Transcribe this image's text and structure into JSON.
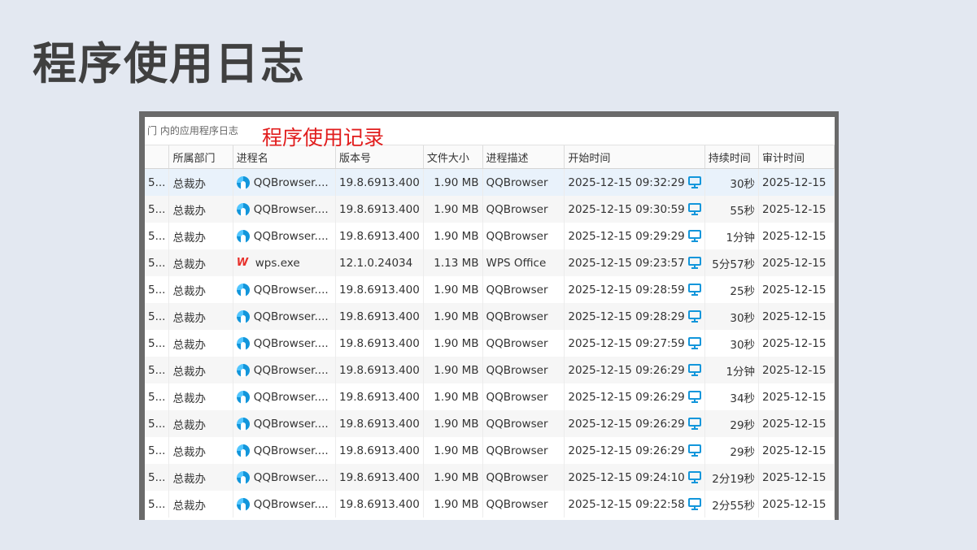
{
  "page": {
    "title": "程序使用日志"
  },
  "panel": {
    "breadcrumb": "门 内的应用程序日志",
    "annotation": "程序使用记录"
  },
  "columns": [
    "",
    "所属部门",
    "进程名",
    "版本号",
    "文件大小",
    "进程描述",
    "开始时间",
    "持续时间",
    "审计时间"
  ],
  "rows": [
    {
      "first": "5...",
      "dept": "总裁办",
      "icon": "qqbrowser-icon",
      "proc": "QQBrowser....",
      "ver": "19.8.6913.400",
      "size": "1.90 MB",
      "desc": "QQBrowser",
      "start": "2025-12-15 09:32:29",
      "dur": "30秒",
      "audit": "2025-12-15"
    },
    {
      "first": "5...",
      "dept": "总裁办",
      "icon": "qqbrowser-icon",
      "proc": "QQBrowser....",
      "ver": "19.8.6913.400",
      "size": "1.90 MB",
      "desc": "QQBrowser",
      "start": "2025-12-15 09:30:59",
      "dur": "55秒",
      "audit": "2025-12-15"
    },
    {
      "first": "5...",
      "dept": "总裁办",
      "icon": "qqbrowser-icon",
      "proc": "QQBrowser....",
      "ver": "19.8.6913.400",
      "size": "1.90 MB",
      "desc": "QQBrowser",
      "start": "2025-12-15 09:29:29",
      "dur": "1分钟",
      "audit": "2025-12-15"
    },
    {
      "first": "5...",
      "dept": "总裁办",
      "icon": "wps-icon",
      "proc": "wps.exe",
      "ver": "12.1.0.24034",
      "size": "1.13 MB",
      "desc": "WPS Office",
      "start": "2025-12-15 09:23:57",
      "dur": "5分57秒",
      "audit": "2025-12-15"
    },
    {
      "first": "5...",
      "dept": "总裁办",
      "icon": "qqbrowser-icon",
      "proc": "QQBrowser....",
      "ver": "19.8.6913.400",
      "size": "1.90 MB",
      "desc": "QQBrowser",
      "start": "2025-12-15 09:28:59",
      "dur": "25秒",
      "audit": "2025-12-15"
    },
    {
      "first": "5...",
      "dept": "总裁办",
      "icon": "qqbrowser-icon",
      "proc": "QQBrowser....",
      "ver": "19.8.6913.400",
      "size": "1.90 MB",
      "desc": "QQBrowser",
      "start": "2025-12-15 09:28:29",
      "dur": "30秒",
      "audit": "2025-12-15"
    },
    {
      "first": "5...",
      "dept": "总裁办",
      "icon": "qqbrowser-icon",
      "proc": "QQBrowser....",
      "ver": "19.8.6913.400",
      "size": "1.90 MB",
      "desc": "QQBrowser",
      "start": "2025-12-15 09:27:59",
      "dur": "30秒",
      "audit": "2025-12-15"
    },
    {
      "first": "5...",
      "dept": "总裁办",
      "icon": "qqbrowser-icon",
      "proc": "QQBrowser....",
      "ver": "19.8.6913.400",
      "size": "1.90 MB",
      "desc": "QQBrowser",
      "start": "2025-12-15 09:26:29",
      "dur": "1分钟",
      "audit": "2025-12-15"
    },
    {
      "first": "5...",
      "dept": "总裁办",
      "icon": "qqbrowser-icon",
      "proc": "QQBrowser....",
      "ver": "19.8.6913.400",
      "size": "1.90 MB",
      "desc": "QQBrowser",
      "start": "2025-12-15 09:26:29",
      "dur": "34秒",
      "audit": "2025-12-15"
    },
    {
      "first": "5...",
      "dept": "总裁办",
      "icon": "qqbrowser-icon",
      "proc": "QQBrowser....",
      "ver": "19.8.6913.400",
      "size": "1.90 MB",
      "desc": "QQBrowser",
      "start": "2025-12-15 09:26:29",
      "dur": "29秒",
      "audit": "2025-12-15"
    },
    {
      "first": "5...",
      "dept": "总裁办",
      "icon": "qqbrowser-icon",
      "proc": "QQBrowser....",
      "ver": "19.8.6913.400",
      "size": "1.90 MB",
      "desc": "QQBrowser",
      "start": "2025-12-15 09:26:29",
      "dur": "29秒",
      "audit": "2025-12-15"
    },
    {
      "first": "5...",
      "dept": "总裁办",
      "icon": "qqbrowser-icon",
      "proc": "QQBrowser....",
      "ver": "19.8.6913.400",
      "size": "1.90 MB",
      "desc": "QQBrowser",
      "start": "2025-12-15 09:24:10",
      "dur": "2分19秒",
      "audit": "2025-12-15"
    },
    {
      "first": "5...",
      "dept": "总裁办",
      "icon": "qqbrowser-icon",
      "proc": "QQBrowser....",
      "ver": "19.8.6913.400",
      "size": "1.90 MB",
      "desc": "QQBrowser",
      "start": "2025-12-15 09:22:58",
      "dur": "2分55秒",
      "audit": "2025-12-15"
    }
  ],
  "colors": {
    "accent": "#1296db",
    "annotation": "#e11d1d",
    "frame": "#6a6a6a",
    "selected_row": "#e9f2fb"
  }
}
